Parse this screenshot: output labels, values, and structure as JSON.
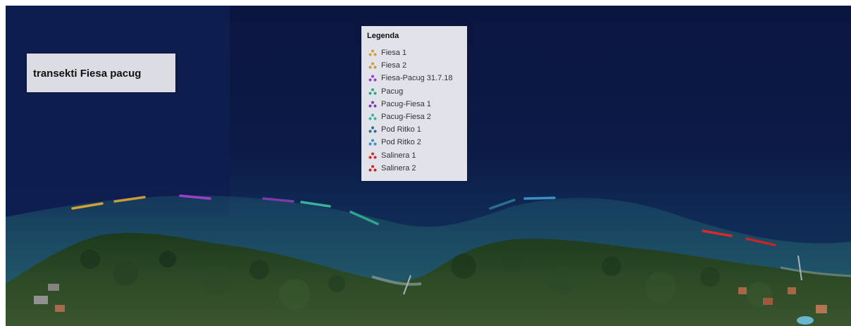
{
  "map": {
    "title": "transekti Fiesa pacug",
    "legend": {
      "title": "Legenda",
      "items": [
        {
          "label": "Fiesa 1",
          "color": "#d4a033"
        },
        {
          "label": "Fiesa 2",
          "color": "#c89a3c"
        },
        {
          "label": "Fiesa-Pacug 31.7.18",
          "color": "#9b3fc9"
        },
        {
          "label": "Pacug",
          "color": "#2fa58a"
        },
        {
          "label": "Pacug-Fiesa 1",
          "color": "#7a3aa8"
        },
        {
          "label": "Pacug-Fiesa 2",
          "color": "#3ab29a"
        },
        {
          "label": "Pod Ritko 1",
          "color": "#2e6f8c"
        },
        {
          "label": "Pod Ritko 2",
          "color": "#3b8fc8"
        },
        {
          "label": "Salinera 1",
          "color": "#d42a2a"
        },
        {
          "label": "Salinera 2",
          "color": "#c0262c"
        }
      ]
    },
    "marker_icon": "point-cluster-icon"
  }
}
